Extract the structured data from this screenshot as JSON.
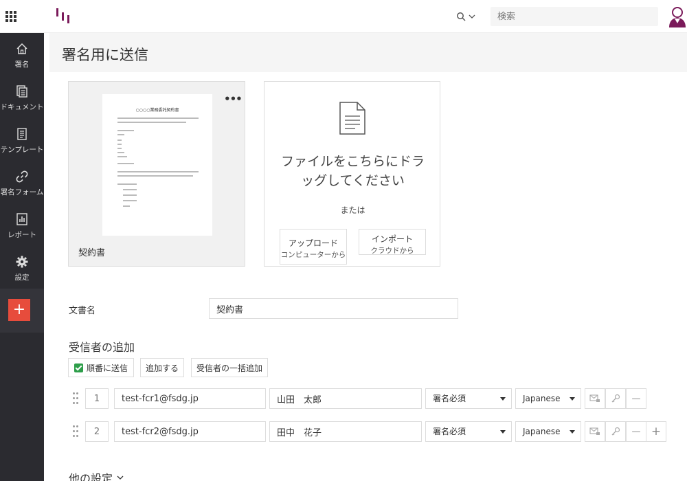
{
  "topbar": {
    "search_placeholder": "検索"
  },
  "sidebar": {
    "items": [
      {
        "label": "署名",
        "icon": "home-icon"
      },
      {
        "label": "ドキュメント",
        "icon": "documents-icon"
      },
      {
        "label": "テンプレート",
        "icon": "template-icon"
      },
      {
        "label": "署名フォーム",
        "icon": "link-icon"
      },
      {
        "label": "レポート",
        "icon": "report-icon"
      },
      {
        "label": "設定",
        "icon": "gear-icon"
      }
    ],
    "plus_label": "+"
  },
  "page": {
    "title": "署名用に送信"
  },
  "document": {
    "name": "契約書",
    "thumbnail_title": "○○○○業務委託契約書",
    "more_label": "•••"
  },
  "upload": {
    "drop_text_1": "ファイルをこちらにドラ",
    "drop_text_2": "ッグしてください",
    "or_text": "または",
    "upload_label": "アップロード",
    "upload_sub": "コンピューターから",
    "import_label": "インポート",
    "import_sub": "クラウドから"
  },
  "form": {
    "doc_name_label": "文書名",
    "doc_name_value": "契約書"
  },
  "recipients": {
    "section_title": "受信者の追加",
    "sequential_label": "順番に送信",
    "add_label": "追加する",
    "bulk_add_label": "受信者の一括追加",
    "rows": [
      {
        "order": "1",
        "email": "test-fcr1@fsdg.jp",
        "name": "山田　太郎",
        "role": "署名必須",
        "language": "Japanese"
      },
      {
        "order": "2",
        "email": "test-fcr2@fsdg.jp",
        "name": "田中　花子",
        "role": "署名必須",
        "language": "Japanese"
      }
    ],
    "minus_label": "—",
    "plus_label": "+"
  },
  "other_settings": {
    "label": "他の設定"
  },
  "colors": {
    "sidebar_bg": "#2b2b30",
    "accent_red": "#e74c3c",
    "check_green": "#2e9e4a",
    "logo_purple": "#7a1a5a"
  }
}
